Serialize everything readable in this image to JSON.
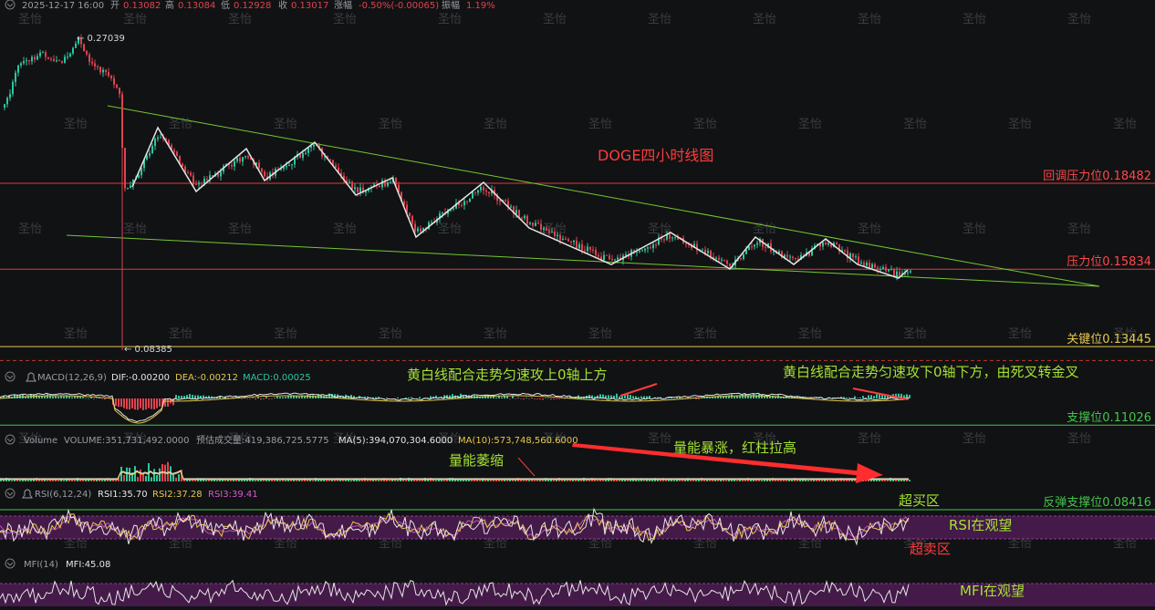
{
  "header": {
    "datetime": "2025-12-17 16:00",
    "open_label": "开",
    "open": "0.13082",
    "high_label": "高",
    "high": "0.13084",
    "low_label": "低",
    "low": "0.12928",
    "close_label": "收",
    "close": "0.13017",
    "change_label": "涨幅",
    "change": "-0.50%(-0.00065)",
    "amplitude_label": "振幅",
    "amplitude": "1.19%"
  },
  "watermark": "圣怡",
  "colors": {
    "background": "#111214",
    "up": "#2bc6a0",
    "down": "#e0424f",
    "resistance": "#e03c3c",
    "key": "#e6c84b",
    "support": "#43c64a",
    "trend": "#74c830",
    "wave": "#e6e6e6",
    "annotation_green": "#a4e232",
    "annotation_red": "#ff3b3b",
    "rsi_band": "#4e1c52"
  },
  "price_chart": {
    "title": "DOGE四小时线图",
    "high_marker": "← 0.27039",
    "low_marker": "← 0.08385",
    "levels": [
      {
        "label": "回调压力位0.18482",
        "value": 0.18482,
        "kind": "resistance"
      },
      {
        "label": "压力位0.15834",
        "value": 0.15834,
        "kind": "resistance"
      },
      {
        "label": "关键位0.13445",
        "value": 0.13445,
        "kind": "key"
      },
      {
        "label": "支撑位0.11026",
        "value": 0.11026,
        "kind": "support"
      },
      {
        "label": "反弹支撑位0.08416",
        "value": 0.08416,
        "kind": "support"
      }
    ],
    "current_price": 0.13017
  },
  "macd": {
    "name": "MACD(12,26,9)",
    "dif": "DIF:-0.00200",
    "dea": "DEA:-0.00212",
    "macd": "MACD:0.00025",
    "note_left": "黄白线配合走势匀速攻上0轴上方",
    "note_right": "黄白线配合走势匀速攻下0轴下方，由死叉转金叉"
  },
  "volume": {
    "name": "Volume",
    "volume": "VOLUME:351,731,492.0000",
    "estimate": "预估成交量:419,386,725.5775",
    "ma5": "MA(5):394,070,304.6000",
    "ma10": "MA(10):573,748,560.6000",
    "note_shrink": "量能萎缩",
    "note_surge": "量能暴涨，红柱拉高"
  },
  "rsi": {
    "name": "RSI(6,12,24)",
    "rsi1": "RSI1:35.70",
    "rsi2": "RSI2:37.28",
    "rsi3": "RSI3:39.41",
    "note_overbought": "超买区",
    "note_watch": "RSI在观望",
    "note_oversold": "超卖区"
  },
  "mfi": {
    "name": "MFI(14)",
    "mfi": "MFI:45.08",
    "note_watch": "MFI在观望"
  }
}
